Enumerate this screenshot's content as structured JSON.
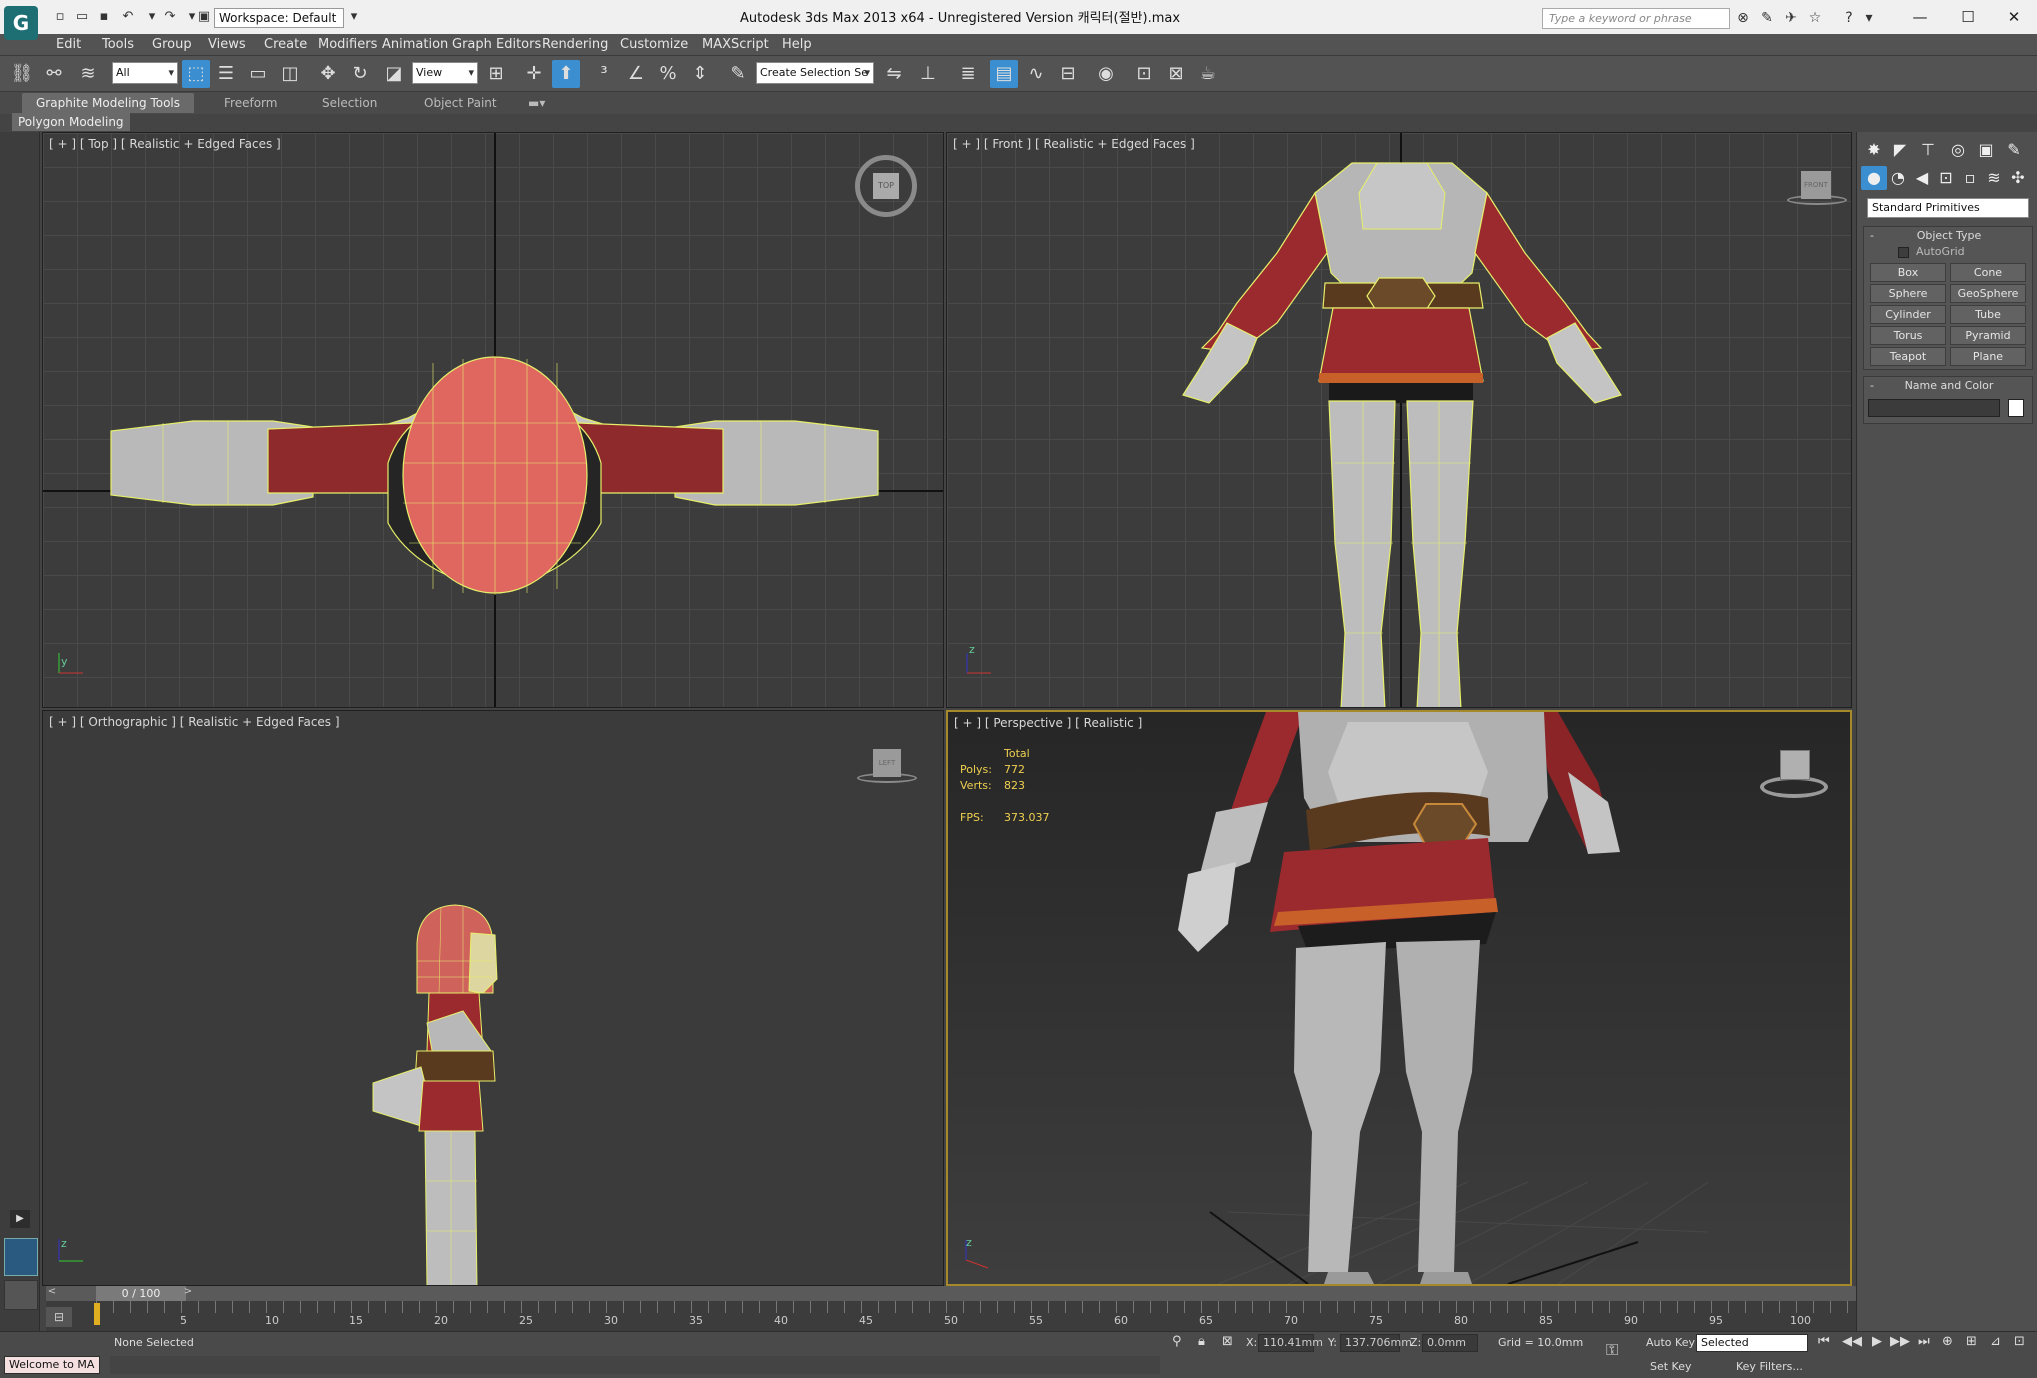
{
  "titlebar": {
    "workspace": "Workspace: Default",
    "title": "Autodesk 3ds Max  2013 x64   - Unregistered Version      캐릭터(절반).max",
    "search_placeholder": "Type a keyword or phrase",
    "logo_icon": "3dsmax-logo-icon"
  },
  "menu": [
    "Edit",
    "Tools",
    "Group",
    "Views",
    "Create",
    "Modifiers",
    "Animation",
    "Graph Editors",
    "Rendering",
    "Customize",
    "MAXScript",
    "Help"
  ],
  "toolbar": {
    "filter_combo": "All",
    "ref_coord_combo": "View",
    "named_selection": "Create Selection Se"
  },
  "ribbon": {
    "tabs": [
      "Graphite Modeling Tools",
      "Freeform",
      "Selection",
      "Object Paint"
    ],
    "active_tab": "Graphite Modeling Tools",
    "sub_tab": "Polygon Modeling"
  },
  "viewports": {
    "top": {
      "label": "[ + ] [ Top ] [ Realistic + Edged Faces ]",
      "cube_label": "TOP"
    },
    "front": {
      "label": "[ + ] [ Front ] [ Realistic + Edged Faces ]",
      "cube_label": "FRONT"
    },
    "ortho": {
      "label": "[ + ] [ Orthographic ] [ Realistic + Edged Faces ]",
      "cube_label": "LEFT"
    },
    "persp": {
      "label": "[ + ] [ Perspective ] [ Realistic ]",
      "stats": {
        "total_label": "Total",
        "polys_label": "Polys:",
        "polys": "772",
        "verts_label": "Verts:",
        "verts": "823",
        "fps_label": "FPS:",
        "fps": "373.037"
      }
    }
  },
  "command_panel": {
    "category": "Standard Primitives",
    "object_type_title": "Object Type",
    "autogrid": "AutoGrid",
    "buttons": [
      "Box",
      "Cone",
      "Sphere",
      "GeoSphere",
      "Cylinder",
      "Tube",
      "Torus",
      "Pyramid",
      "Teapot",
      "Plane"
    ],
    "name_color_title": "Name and Color",
    "swatch_color": "#ffffff"
  },
  "timeline": {
    "frame": "0 / 100",
    "ticks": [
      "5",
      "10",
      "15",
      "20",
      "25",
      "30",
      "35",
      "40",
      "45",
      "50",
      "55",
      "60",
      "65",
      "70",
      "75",
      "80",
      "85",
      "90",
      "95",
      "100"
    ]
  },
  "status": {
    "selection": "None Selected",
    "x_label": "X:",
    "x": "110.41mm",
    "y_label": "Y:",
    "y": "137.706mm",
    "z_label": "Z:",
    "z": "0.0mm",
    "grid": "Grid = 10.0mm",
    "auto_key": "Auto Key",
    "selected_combo": "Selected",
    "set_key": "Set Key",
    "key_filters": "Key Filters...",
    "listener": "Welcome to MA"
  },
  "colors": {
    "accent": "#3b8fd0",
    "wire": "#e6ef6a",
    "armor": "#c9c9c9",
    "cloth": "#9b2a2e",
    "active_border": "#a68a2a"
  }
}
